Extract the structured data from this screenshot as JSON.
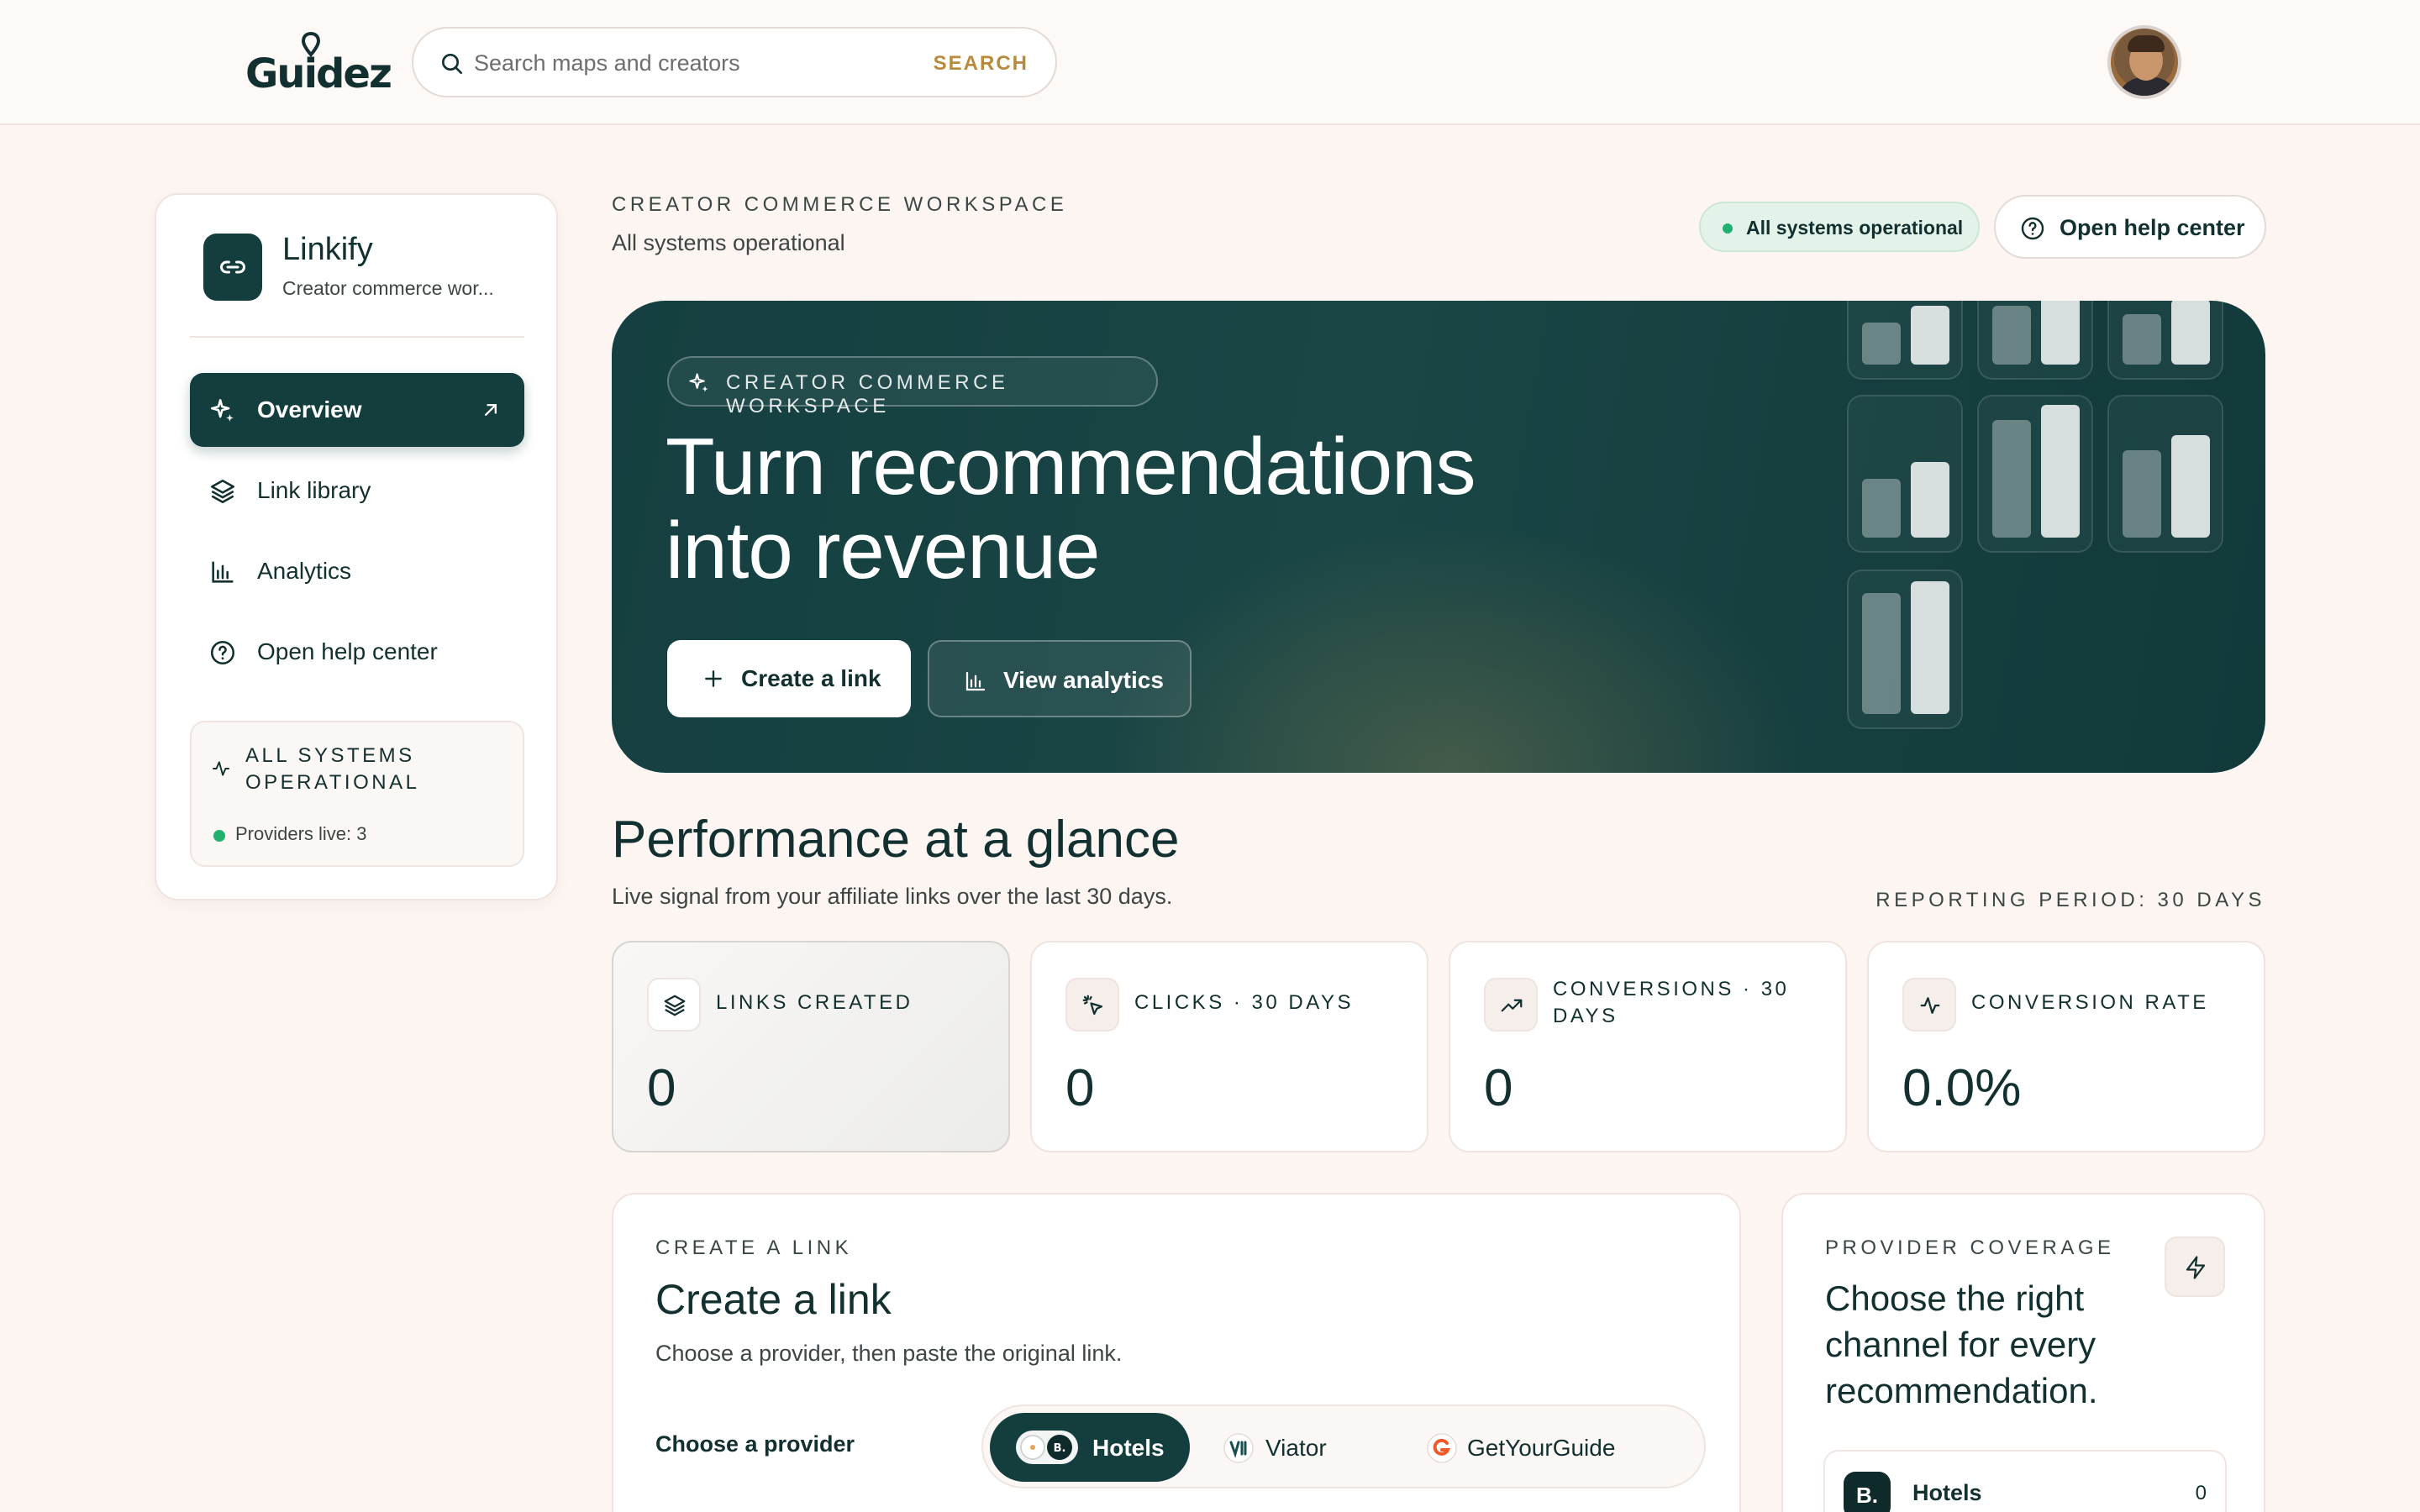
{
  "topbar": {
    "logo_text": "Guidez",
    "search_placeholder": "Search maps and creators",
    "search_button": "SEARCH"
  },
  "sidebar": {
    "brand_title": "Linkify",
    "brand_subtitle": "Creator commerce wor...",
    "items": [
      {
        "label": "Overview",
        "icon": "sparkle-icon",
        "active": true
      },
      {
        "label": "Link library",
        "icon": "layers-icon",
        "active": false
      },
      {
        "label": "Analytics",
        "icon": "bar-chart-icon",
        "active": false
      },
      {
        "label": "Open help center",
        "icon": "help-circle-icon",
        "active": false
      }
    ],
    "status": {
      "title": "ALL SYSTEMS OPERATIONAL",
      "providers": "Providers live: 3"
    }
  },
  "header": {
    "eyebrow": "CREATOR COMMERCE WORKSPACE",
    "subtitle": "All systems operational",
    "status_pill": "All systems operational",
    "help_button": "Open help center"
  },
  "hero": {
    "eyebrow": "CREATOR COMMERCE WORKSPACE",
    "title_line1": "Turn recommendations",
    "title_line2": "into revenue",
    "primary_button": "Create a link",
    "secondary_button": "View analytics"
  },
  "performance": {
    "title": "Performance at a glance",
    "subtitle": "Live signal from your affiliate links over the last 30 days.",
    "period": "REPORTING PERIOD: 30 DAYS",
    "stats": [
      {
        "label": "LINKS CREATED",
        "value": "0",
        "icon": "layers-icon"
      },
      {
        "label": "CLICKS · 30 DAYS",
        "value": "0",
        "icon": "cursor-click-icon"
      },
      {
        "label": "CONVERSIONS · 30 DAYS",
        "value": "0",
        "icon": "trending-up-icon"
      },
      {
        "label": "CONVERSION RATE",
        "value": "0.0%",
        "icon": "activity-icon"
      }
    ]
  },
  "create_link": {
    "eyebrow": "CREATE A LINK",
    "title": "Create a link",
    "subtitle": "Choose a provider, then paste the original link.",
    "choose_label": "Choose a provider",
    "providers": [
      "Hotels",
      "Viator",
      "GetYourGuide"
    ],
    "selected": "Hotels"
  },
  "provider_coverage": {
    "eyebrow": "PROVIDER COVERAGE",
    "title": "Choose the right channel for every recommendation.",
    "rows": [
      {
        "logo": "B.",
        "name": "Hotels",
        "count": "0"
      }
    ]
  },
  "colors": {
    "primary": "#143e3e",
    "background": "#fdf5f2",
    "accent_gold": "#b88a3e",
    "success": "#22b070"
  }
}
